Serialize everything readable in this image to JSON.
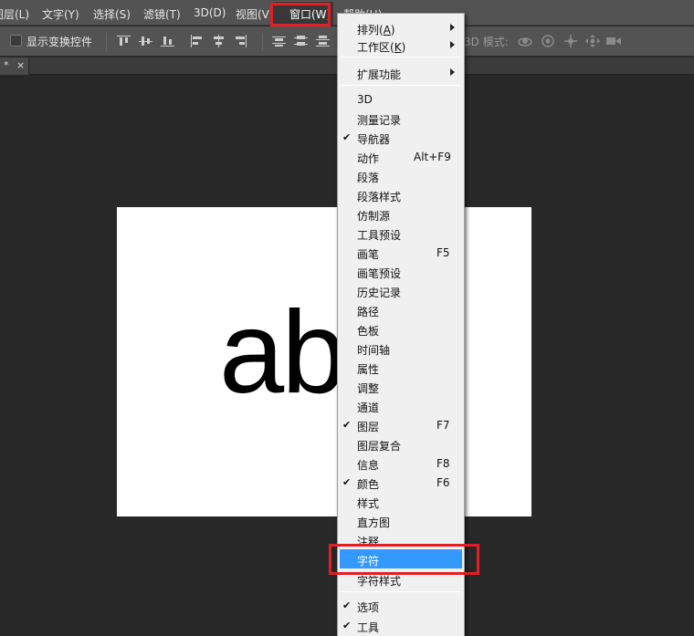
{
  "menubar": {
    "items": [
      "图层(L)",
      "文字(Y)",
      "选择(S)",
      "滤镜(T)",
      "3D(D)",
      "视图(V)",
      "窗口(W)",
      "帮助(H)"
    ]
  },
  "options_bar": {
    "show_transform_controls": "显示变换控件",
    "mode_3d_label": "3D 模式:"
  },
  "document_tab": {
    "marker": "*",
    "close": "×"
  },
  "canvas": {
    "text": "ab"
  },
  "window_menu": {
    "items": [
      {
        "label_main": "排列(",
        "label_key": "A",
        "label_end": ")",
        "submenu": true
      },
      {
        "label_main": "工作区(",
        "label_key": "K",
        "label_end": ")",
        "submenu": true
      },
      {
        "label": "扩展功能",
        "submenu": true
      },
      {
        "label": "3D"
      },
      {
        "label": "测量记录"
      },
      {
        "label": "导航器",
        "checked": "✔"
      },
      {
        "label": "动作",
        "shortcut": "Alt+F9"
      },
      {
        "label": "段落"
      },
      {
        "label": "段落样式"
      },
      {
        "label": "仿制源"
      },
      {
        "label": "工具预设"
      },
      {
        "label": "画笔",
        "shortcut": "F5"
      },
      {
        "label": "画笔预设"
      },
      {
        "label": "历史记录"
      },
      {
        "label": "路径"
      },
      {
        "label": "色板"
      },
      {
        "label": "时间轴"
      },
      {
        "label": "属性"
      },
      {
        "label": "调整"
      },
      {
        "label": "通道"
      },
      {
        "label": "图层",
        "checked": "✔",
        "shortcut": "F7"
      },
      {
        "label": "图层复合"
      },
      {
        "label": "信息",
        "shortcut": "F8"
      },
      {
        "label": "颜色",
        "checked": "✔",
        "shortcut": "F6"
      },
      {
        "label": "样式"
      },
      {
        "label": "直方图"
      },
      {
        "label": "注释"
      },
      {
        "label": "字符",
        "selected": true
      },
      {
        "label": "字符样式"
      },
      {
        "label": "选项",
        "checked": "✔"
      },
      {
        "label": "工具",
        "checked": "✔"
      }
    ]
  },
  "colors": {
    "highlight": "#3399ff",
    "annotation_box": "#e01e24"
  }
}
